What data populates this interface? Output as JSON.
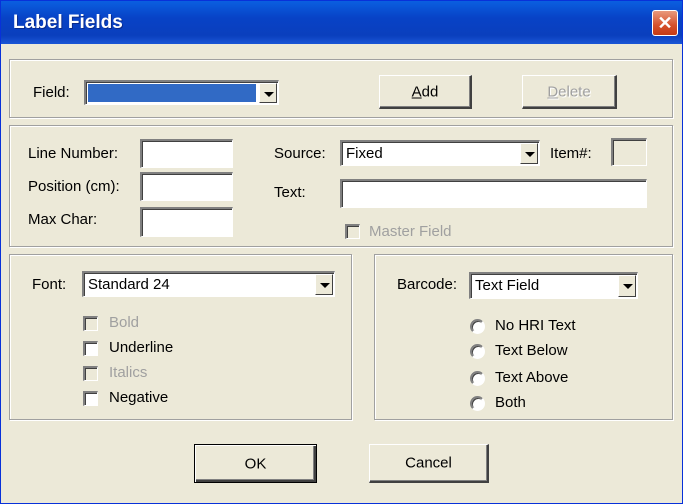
{
  "window": {
    "title": "Label Fields",
    "close_glyph": "✕"
  },
  "field": {
    "label": "Field:",
    "value": ""
  },
  "buttons": {
    "add_prefix": "",
    "add_accel": "A",
    "add_rest": "dd",
    "delete_accel": "D",
    "delete_rest": "elete",
    "ok": "OK",
    "cancel": "Cancel"
  },
  "position": {
    "line_number_label": "Line Number:",
    "position_label": "Position (cm):",
    "max_char_label": "Max Char:",
    "line_number_value": "",
    "position_value": "",
    "max_char_value": ""
  },
  "source": {
    "label": "Source:",
    "value": "Fixed",
    "item_label": "Item#:",
    "item_value": "",
    "text_label": "Text:",
    "text_value": "",
    "master_field_label": "Master Field"
  },
  "font": {
    "label": "Font:",
    "value": "Standard 24",
    "bold_label": "Bold",
    "underline_label": "Underline",
    "italics_label": "Italics",
    "negative_label": "Negative"
  },
  "barcode": {
    "label": "Barcode:",
    "value": "Text Field",
    "options": [
      "No HRI Text",
      "Text Below",
      "Text Above",
      "Both"
    ]
  },
  "colors": {
    "title_bar": "#0842c6",
    "dialog_bg": "#ece9d8",
    "selection": "#316ac5",
    "close": "#d5502c"
  }
}
